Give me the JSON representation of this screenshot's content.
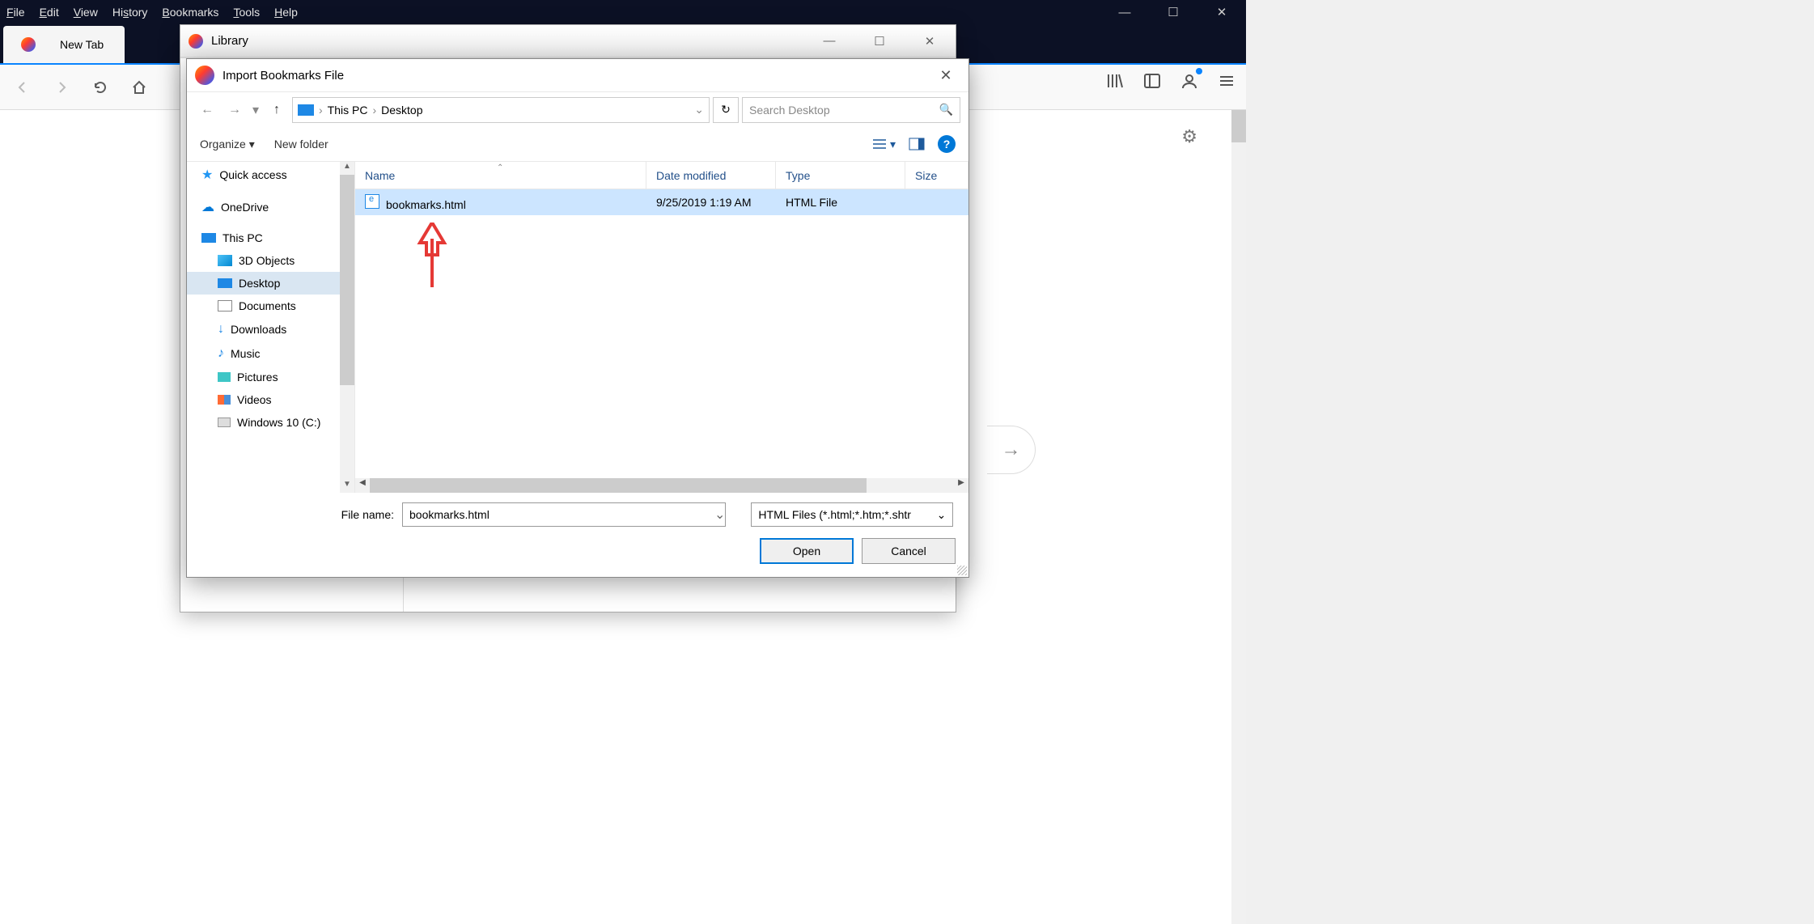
{
  "menubar": {
    "file": "File",
    "edit": "Edit",
    "view": "View",
    "history": "History",
    "bookmarks": "Bookmarks",
    "tools": "Tools",
    "help": "Help"
  },
  "tab": {
    "title": "New Tab"
  },
  "library": {
    "title": "Library"
  },
  "dialog": {
    "title": "Import Bookmarks File",
    "path": {
      "root": "This PC",
      "folder": "Desktop"
    },
    "search_placeholder": "Search Desktop",
    "organize": "Organize",
    "newfolder": "New folder",
    "columns": {
      "name": "Name",
      "date": "Date modified",
      "type": "Type",
      "size": "Size"
    },
    "file": {
      "name": "bookmarks.html",
      "date": "9/25/2019 1:19 AM",
      "type": "HTML File"
    },
    "filename_label": "File name:",
    "filename_value": "bookmarks.html",
    "filter": "HTML Files (*.html;*.htm;*.shtr",
    "open": "Open",
    "cancel": "Cancel"
  },
  "tree": {
    "quick": "Quick access",
    "onedrive": "OneDrive",
    "thispc": "This PC",
    "objects": "3D Objects",
    "desktop": "Desktop",
    "documents": "Documents",
    "downloads": "Downloads",
    "music": "Music",
    "pictures": "Pictures",
    "videos": "Videos",
    "c": "Windows 10 (C:)"
  }
}
